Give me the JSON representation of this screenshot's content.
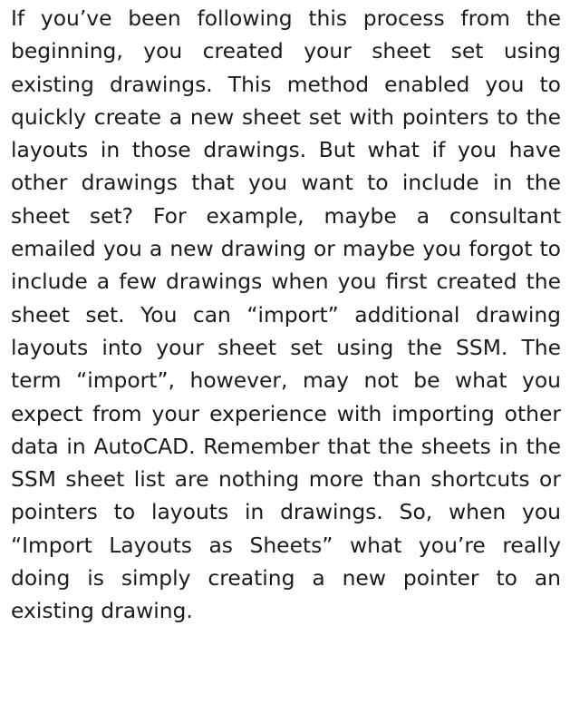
{
  "document": {
    "paragraph": "If you’ve been following this process from the beginning, you created your sheet set using existing drawings. This method enabled you to quickly create a new sheet set with pointers to the layouts in those drawings. But what if you have other drawings that you want to include in the sheet set? For example, maybe a consultant emailed you a new drawing or maybe you forgot to include a few drawings when you first created the sheet set. You can “import” additional drawing layouts into your sheet set using the SSM. The term “import”, however, may not be what you expect from your experience with importing other data in AutoCAD. Remember that the sheets in the SSM sheet list are nothing more than shortcuts or pointers to layouts in drawings. So, when you “Import Layouts as Sheets” what you’re really doing is simply creating a new pointer to an existing drawing."
  }
}
